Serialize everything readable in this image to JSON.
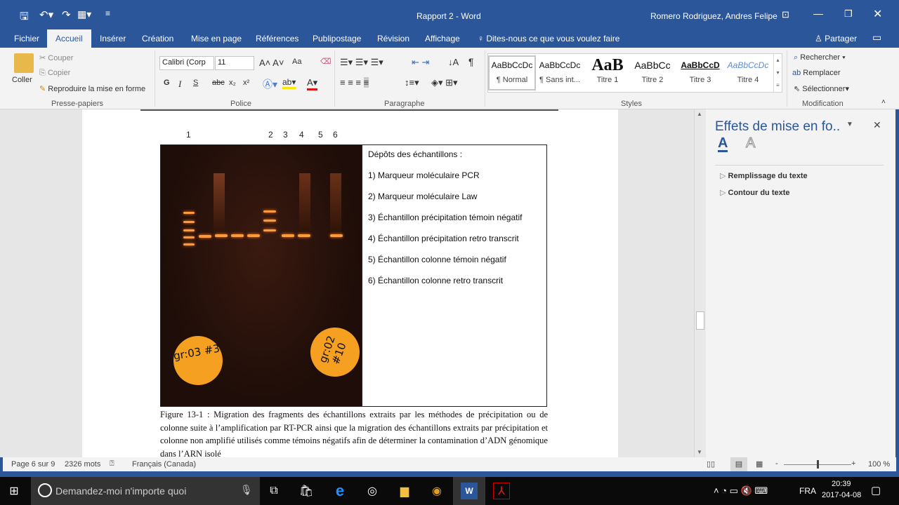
{
  "window": {
    "title": "Rapport 2  -  Word",
    "user": "Romero Rodriguez, Andres Felipe"
  },
  "tabs": [
    "Fichier",
    "Accueil",
    "Insérer",
    "Création",
    "Mise en page",
    "Références",
    "Publipostage",
    "Révision",
    "Affichage"
  ],
  "tell_me": "Dites-nous ce que vous voulez faire",
  "share": "Partager",
  "clipboard": {
    "paste": "Coller",
    "cut": "Couper",
    "copy": "Copier",
    "format_painter": "Reproduire la mise en forme",
    "label": "Presse-papiers"
  },
  "font": {
    "name": "Calibri (Corp",
    "size": "11",
    "bold": "G",
    "italic": "I",
    "underline": "S",
    "strike": "abc",
    "sub": "x₂",
    "sup": "x²",
    "case": "Aa",
    "label": "Police"
  },
  "paragraph": {
    "label": "Paragraphe"
  },
  "styles": {
    "label": "Styles",
    "items": [
      {
        "preview": "AaBbCcDc",
        "name": "¶ Normal"
      },
      {
        "preview": "AaBbCcDc",
        "name": "¶ Sans int..."
      },
      {
        "preview": "AaB",
        "name": "Titre 1"
      },
      {
        "preview": "AaBbCc",
        "name": "Titre 2"
      },
      {
        "preview": "AaBbCcD",
        "name": "Titre 3"
      },
      {
        "preview": "AaBbCcDc",
        "name": "Titre 4"
      }
    ]
  },
  "editing": {
    "find": "Rechercher",
    "replace": "Remplacer",
    "select": "Sélectionner",
    "label": "Modification"
  },
  "document": {
    "lane_numbers": [
      "1",
      "2",
      "3",
      "4",
      "5",
      "6"
    ],
    "gel_labels": [
      "gr:03 #3",
      "gr:02 #10"
    ],
    "legend": [
      "Dépôts des échantillons :",
      "1) Marqueur moléculaire PCR",
      "2) Marqueur moléculaire Law",
      "3) Échantillon  précipitation  témoin négatif",
      "4) Échantillon  précipitation  retro transcrit",
      "5) Échantillon  colonne témoin négatif",
      "6) Échantillon  colonne retro transcrit"
    ],
    "caption": "Figure 13-1 : Migration des fragments des échantillons extraits par les méthodes de précipitation ou de colonne suite à l’amplification par RT-PCR ainsi que la migration des échantillons extraits par précipitation et colonne non amplifié utilisés comme témoins négatifs afin de déterminer la contamination d’ADN génomique dans l’ARN isolé"
  },
  "pane": {
    "title": "Effets de mise en fo..",
    "items": [
      "Remplissage du texte",
      "Contour du texte"
    ]
  },
  "status": {
    "page": "Page 6 sur 9",
    "words": "2326 mots",
    "language": "Français (Canada)",
    "zoom": "100 %",
    "zoom_percent": 100
  },
  "taskbar": {
    "search": "Demandez-moi n'importe quoi",
    "lang": "FRA",
    "time": "20:39",
    "date": "2017-04-08"
  }
}
